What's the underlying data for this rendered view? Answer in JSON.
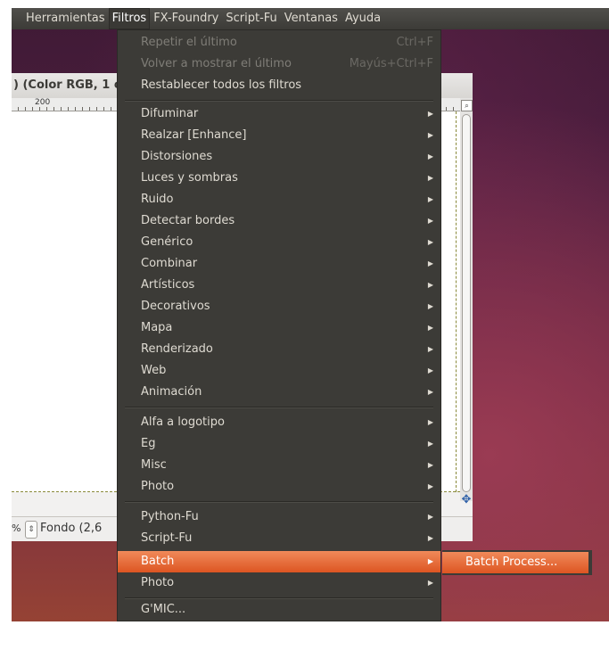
{
  "menubar": {
    "items": [
      "Herramientas",
      "Filtros",
      "FX-Foundry",
      "Script-Fu",
      "Ventanas",
      "Ayuda"
    ],
    "active": "Filtros"
  },
  "gimp_window": {
    "title": ") (Color RGB, 1 c",
    "ruler_label": "200",
    "zoom_unit": "%",
    "layer_status": "Fondo (2,6"
  },
  "filtros_menu": {
    "top_items": [
      {
        "label": "Repetir el último",
        "shortcut": "Ctrl+F",
        "disabled": true
      },
      {
        "label": "Volver a mostrar el último",
        "shortcut": "Mayús+Ctrl+F",
        "disabled": true
      },
      {
        "label": "Restablecer todos los filtros",
        "shortcut": "",
        "disabled": false
      }
    ],
    "group1": [
      "Difuminar",
      "Realzar [Enhance]",
      "Distorsiones",
      "Luces y sombras",
      "Ruido",
      "Detectar bordes",
      "Genérico",
      "Combinar",
      "Artísticos",
      "Decorativos",
      "Mapa",
      "Renderizado",
      "Web",
      "Animación"
    ],
    "group2": [
      "Alfa a logotipo",
      "Eg",
      "Misc",
      "Photo"
    ],
    "group3": [
      "Python-Fu",
      "Script-Fu",
      "Batch",
      "Photo"
    ],
    "group4": [
      "G'MIC..."
    ],
    "highlighted": "Batch"
  },
  "batch_submenu": {
    "items": [
      "Batch Process..."
    ]
  },
  "colors": {
    "menu_bg": "#3c3b37",
    "highlight": "#dd5522",
    "text": "#dfdbd2"
  }
}
